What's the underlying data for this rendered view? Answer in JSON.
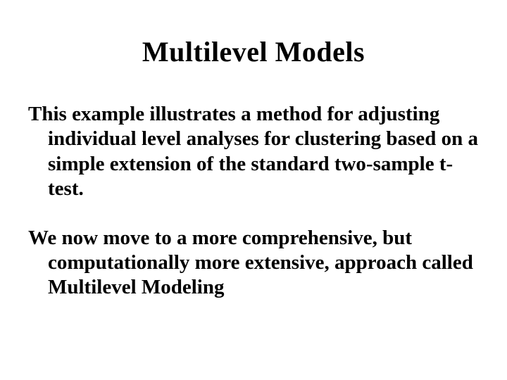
{
  "slide": {
    "title": "Multilevel Models",
    "paragraph1": "This example illustrates a method for adjusting individual level analyses for clustering based on a simple extension of the standard two-sample t-test.",
    "paragraph2": "We now move to a more comprehensive, but computationally more extensive, approach called Multilevel Modeling"
  }
}
